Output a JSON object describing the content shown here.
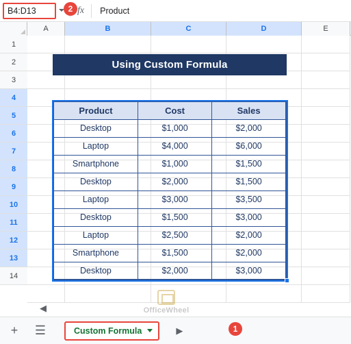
{
  "formula_bar": {
    "name_box_value": "B4:D13",
    "fx_label": "fx",
    "formula_value": "Product",
    "dropdown_icon": "chevron-down-icon"
  },
  "callouts": [
    {
      "id": "2",
      "label": "2"
    },
    {
      "id": "1",
      "label": "1"
    }
  ],
  "grid": {
    "column_headers": [
      "A",
      "B",
      "C",
      "D",
      "E"
    ],
    "row_headers": [
      "1",
      "2",
      "3",
      "4",
      "5",
      "6",
      "7",
      "8",
      "9",
      "10",
      "11",
      "12",
      "13",
      "14"
    ],
    "selected_columns": [
      "B",
      "C",
      "D"
    ],
    "selected_rows": [
      "4",
      "5",
      "6",
      "7",
      "8",
      "9",
      "10",
      "11",
      "12",
      "13"
    ]
  },
  "sheet": {
    "title": "Using Custom Formula",
    "table": {
      "headers": [
        "Product",
        "Cost",
        "Sales"
      ],
      "rows": [
        [
          "Desktop",
          "$1,000",
          "$2,000"
        ],
        [
          "Laptop",
          "$4,000",
          "$6,000"
        ],
        [
          "Smartphone",
          "$1,000",
          "$1,500"
        ],
        [
          "Desktop",
          "$2,000",
          "$1,500"
        ],
        [
          "Laptop",
          "$3,000",
          "$3,500"
        ],
        [
          "Desktop",
          "$1,500",
          "$3,000"
        ],
        [
          "Laptop",
          "$2,500",
          "$2,000"
        ],
        [
          "Smartphone",
          "$1,500",
          "$2,000"
        ],
        [
          "Desktop",
          "$2,000",
          "$3,000"
        ]
      ]
    }
  },
  "watermark": {
    "text": "OfficeWheel"
  },
  "bottom_bar": {
    "add_sheet_label": "+",
    "all_sheets_label": "☰",
    "sheet_tab_name": "Custom Formula",
    "next_label": "▶"
  },
  "colors": {
    "header_fill": "#d9e2f3",
    "banner_fill": "#1f3864",
    "table_border": "#2f5496",
    "selection": "#1a73e8",
    "callout": "#e8453c",
    "tab_text": "#137333"
  }
}
